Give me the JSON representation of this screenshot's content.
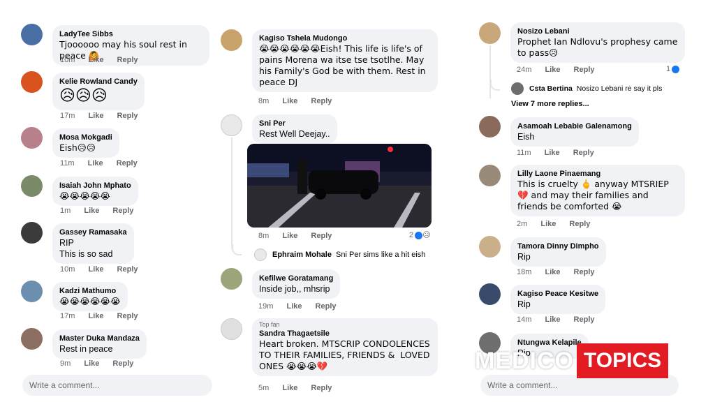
{
  "col1": {
    "comments": [
      {
        "name": "LadyTee Sibbs",
        "text": "Tjoooooo may his soul rest in peace 🙆",
        "time": "10m",
        "like": "Like",
        "reply": "Reply"
      },
      {
        "name": "Kelie Rowland Candy",
        "text": "😥😥😥",
        "time": "17m",
        "like": "Like",
        "reply": "Reply"
      },
      {
        "name": "Mosa Mokgadi",
        "text": "Eish😥😥",
        "time": "11m",
        "like": "Like",
        "reply": "Reply"
      },
      {
        "name": "Isaiah John Mphato",
        "text": "😭😭😭😭😭",
        "time": "1m",
        "like": "Like",
        "reply": "Reply"
      },
      {
        "name": "Gassey Ramasaka",
        "text": "RIP\nThis is so sad",
        "time": "10m",
        "like": "Like",
        "reply": "Reply"
      },
      {
        "name": "Kadzi Mathumo",
        "text": "😭😭😭😭😭😭",
        "time": "17m",
        "like": "Like",
        "reply": "Reply"
      },
      {
        "name": "Master Duka Mandaza",
        "text": "Rest in peace",
        "time": "9m",
        "like": "Like",
        "reply": "Reply"
      }
    ],
    "write_placeholder": "Write a comment..."
  },
  "col2": {
    "comments": [
      {
        "name": "Kagiso Tshela Mudongo",
        "text": "😭😭😭😭😭😭Eish! This life is life's of pains Morena wa itse tse tsotlhe. May his Family's God be with them. Rest in peace DJ",
        "time": "8m",
        "like": "Like",
        "reply": "Reply"
      },
      {
        "name": "Sni Per",
        "text": "Rest Well Deejay..",
        "time": "8m",
        "like": "Like",
        "reply": "Reply",
        "reactions": "2"
      },
      {
        "name": "Kefilwe Goratamang",
        "text": "Inside job,, mhsrip",
        "time": "19m",
        "like": "Like",
        "reply": "Reply"
      },
      {
        "name": "Sandra Thagaetsile",
        "badge": "Top fan",
        "text": "Heart broken. MTSCRIP CONDOLENCES TO THEIR FAMILIES, FRIENDS &  LOVED ONES 😭😭😭💔",
        "time": "5m",
        "like": "Like",
        "reply": "Reply"
      }
    ],
    "nested_reply": {
      "name": "Ephraim Mohale",
      "text": "Sni Per sims like a hit eish"
    }
  },
  "col3": {
    "comments": [
      {
        "name": "Nosizo Lebani",
        "text": "Prophet Ian Ndlovu's prophesy came to pass😥",
        "time": "24m",
        "like": "Like",
        "reply": "Reply",
        "reactions": "1"
      },
      {
        "name": "Asamoah Lebabie Galenamong",
        "text": "Eish",
        "time": "11m",
        "like": "Like",
        "reply": "Reply"
      },
      {
        "name": "Lilly Laone Pinaemang",
        "text": "This is cruelty 🖕 anyway MTSRIEP 💔 and may their families and friends be comforted 😭",
        "time": "2m",
        "like": "Like",
        "reply": "Reply"
      },
      {
        "name": "Tamora Dinny Dimpho",
        "text": "Rip",
        "time": "18m",
        "like": "Like",
        "reply": "Reply"
      },
      {
        "name": "Kagiso Peace Kesitwe",
        "text": "Rip",
        "time": "14m",
        "like": "Like",
        "reply": "Reply"
      },
      {
        "name": "Ntungwa Kelapile",
        "text": "Rip",
        "time": "",
        "like": "",
        "reply": ""
      }
    ],
    "nested_reply": {
      "name": "Csta Bertina",
      "text": "Nosizo Lebani re say it pls"
    },
    "view_more": "View 7 more replies...",
    "write_placeholder": "Write a comment..."
  },
  "watermark": {
    "part1": "MEDICO",
    "part2": "TOPICS"
  },
  "colors": {
    "bubble": "#f0f2f5",
    "meta": "#65676b",
    "brand_red": "#e31b23",
    "like_blue": "#1877f2"
  }
}
